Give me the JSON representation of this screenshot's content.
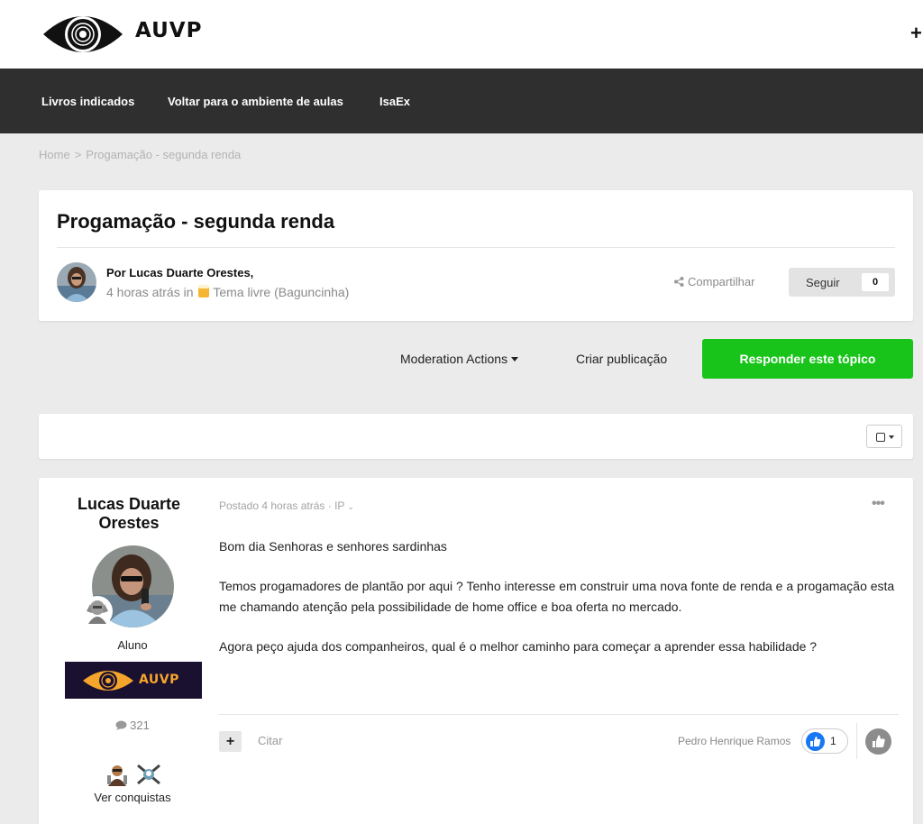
{
  "header": {
    "logo_text": "AUVP",
    "plus": "+"
  },
  "nav": {
    "items": [
      {
        "label": "Livros indicados"
      },
      {
        "label": "Voltar para o ambiente de aulas"
      },
      {
        "label": "IsaEx"
      }
    ]
  },
  "breadcrumb": {
    "home": "Home",
    "separator": ">",
    "current": "Progamação - segunda renda"
  },
  "topic": {
    "title": "Progamação - segunda renda",
    "by_line": "Por Lucas Duarte Orestes,",
    "time": "4 horas atrás in",
    "forum": "Tema livre (Baguncinha)",
    "share_label": "Compartilhar",
    "follow_label": "Seguir",
    "follow_count": "0"
  },
  "actions": {
    "moderation": "Moderation Actions",
    "create_post": "Criar publicação",
    "reply": "Responder este tópico"
  },
  "post": {
    "author_name": "Lucas Duarte Orestes",
    "group": "Aluno",
    "banner_text": "AUVP",
    "post_count": "321",
    "achievements_link": "Ver conquistas",
    "meta": "Postado 4 horas atrás · IP",
    "menu": "•••",
    "body": [
      "Bom dia Senhoras e senhores sardinhas",
      "Temos progamadores de plantão por aqui ?  Tenho interesse em construir uma nova fonte de renda e a progamação esta me chamando atenção pela possibilidade de home office e boa oferta no mercado.",
      "Agora peço ajuda dos companheiros, qual é o melhor caminho para começar a aprender essa habilidade ?"
    ],
    "multiquote": "+",
    "quote": "Citar",
    "reacted_by": "Pedro Henrique Ramos",
    "reaction_count": "1"
  },
  "colors": {
    "navbar": "#2f2f2f",
    "reply_button": "#18c41a",
    "page_bg": "#ebebeb",
    "like_blue": "#1877f2",
    "banner_bg": "#1a1030",
    "banner_accent": "#f5a52b"
  },
  "icons": {
    "logo": "eye-logo-icon",
    "share": "share-icon",
    "forum": "beer-icon",
    "post_count": "speech-bubble-icon",
    "like": "thumbs-up-icon"
  }
}
